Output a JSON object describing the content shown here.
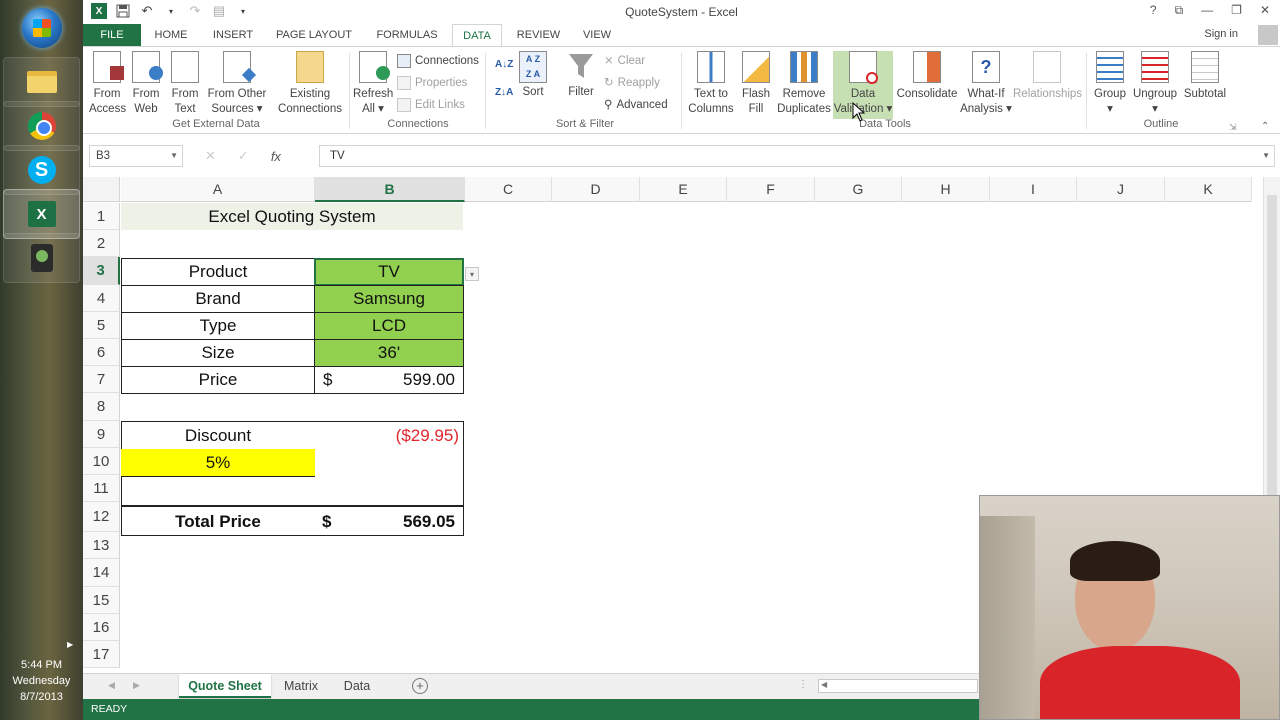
{
  "taskbar": {
    "clock_time": "5:44 PM",
    "clock_day": "Wednesday",
    "clock_date": "8/7/2013"
  },
  "window": {
    "title": "QuoteSystem - Excel",
    "help": "?",
    "signin": "Sign in"
  },
  "menu": {
    "tabs": [
      "FILE",
      "HOME",
      "INSERT",
      "PAGE LAYOUT",
      "FORMULAS",
      "DATA",
      "REVIEW",
      "VIEW"
    ],
    "active": "DATA"
  },
  "ribbon": {
    "get_external": {
      "label": "Get External Data",
      "from_access": [
        "From",
        "Access"
      ],
      "from_web": [
        "From",
        "Web"
      ],
      "from_text": [
        "From",
        "Text"
      ],
      "from_other": [
        "From Other",
        "Sources ▾"
      ],
      "existing": [
        "Existing",
        "Connections"
      ]
    },
    "connections": {
      "label": "Connections",
      "refresh": [
        "Refresh",
        "All ▾"
      ],
      "connections": "Connections",
      "properties": "Properties",
      "edit_links": "Edit Links"
    },
    "sort_filter": {
      "label": "Sort & Filter",
      "sort": "Sort",
      "filter": "Filter",
      "clear": "Clear",
      "reapply": "Reapply",
      "advanced": "Advanced"
    },
    "data_tools": {
      "label": "Data Tools",
      "text_to_columns": [
        "Text to",
        "Columns"
      ],
      "flash_fill": [
        "Flash",
        "Fill"
      ],
      "remove_duplicates": [
        "Remove",
        "Duplicates"
      ],
      "data_validation": [
        "Data",
        "Validation ▾"
      ],
      "consolidate": "Consolidate",
      "what_if": [
        "What-If",
        "Analysis ▾"
      ],
      "relationships": "Relationships"
    },
    "outline": {
      "label": "Outline",
      "group": "Group",
      "ungroup": "Ungroup",
      "subtotal": "Subtotal"
    }
  },
  "formula_bar": {
    "name_box": "B3",
    "fx": "fx",
    "value": "TV"
  },
  "grid": {
    "columns": [
      "A",
      "B",
      "C",
      "D",
      "E",
      "F",
      "G",
      "H",
      "I",
      "J",
      "K"
    ],
    "rows": [
      "1",
      "2",
      "3",
      "4",
      "5",
      "6",
      "7",
      "8",
      "9",
      "10",
      "11",
      "12",
      "13",
      "14",
      "15",
      "16",
      "17"
    ],
    "title": "Excel Quoting System",
    "labels": {
      "product": "Product",
      "brand": "Brand",
      "type": "Type",
      "size": "Size",
      "price": "Price",
      "discount": "Discount",
      "discount_pct": "5%",
      "total": "Total Price"
    },
    "values": {
      "product": "TV",
      "brand": "Samsung",
      "type": "LCD",
      "size": "36'",
      "price_currency": "$",
      "price": "599.00",
      "discount": "($29.95)",
      "total_currency": "$",
      "total": "569.05"
    }
  },
  "sheets": {
    "tabs": [
      "Quote Sheet",
      "Matrix",
      "Data"
    ],
    "active": "Quote Sheet"
  },
  "status": {
    "text": "READY"
  },
  "colors": {
    "excel_green": "#217346",
    "cell_green": "#92d050",
    "cell_yellow": "#ffff00",
    "negative_red": "#e0262b"
  }
}
